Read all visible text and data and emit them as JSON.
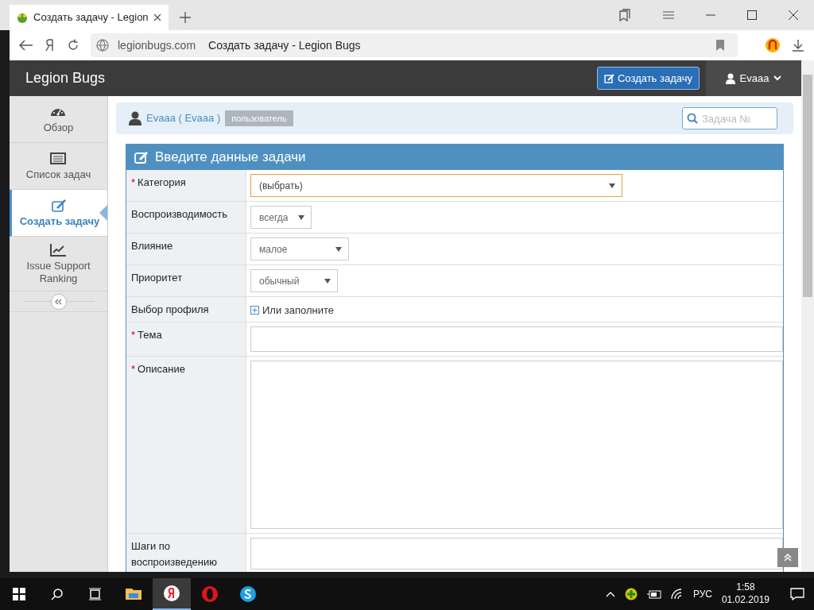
{
  "browser": {
    "tab_title": "Создать задачу - Legion",
    "domain": "legionbugs.com",
    "page_title": "Создать задачу - Legion Bugs"
  },
  "navbar": {
    "brand": "Legion Bugs",
    "create_button": "Создать задачу",
    "user": "Evaaa"
  },
  "sidebar": {
    "items": [
      {
        "label": "Обзор",
        "selected": false
      },
      {
        "label": "Список задач",
        "selected": false
      },
      {
        "label": "Создать задачу",
        "selected": true
      },
      {
        "label": "Issue Support Ranking",
        "selected": false
      }
    ]
  },
  "user_bar": {
    "user": "Evaaa ( Evaaa )",
    "role": "пользователь",
    "search_placeholder": "Задача №"
  },
  "form": {
    "title": "Введите данные задачи",
    "fields": [
      {
        "mark": "*",
        "label": "Категория",
        "kind": "select",
        "value": "(выбрать)",
        "focused": true
      },
      {
        "label": "Воспроизводимость",
        "kind": "select",
        "value": "всегда",
        "focused": false
      },
      {
        "label": "Влияние",
        "kind": "select",
        "value": "малое",
        "focused": false
      },
      {
        "label": "Приоритет",
        "kind": "select",
        "value": "обычный",
        "focused": false
      },
      {
        "label": "Выбор профиля",
        "kind": "link",
        "value": "Или заполните"
      },
      {
        "mark": "*",
        "label": "Тема",
        "kind": "input"
      },
      {
        "mark": "*",
        "label": "Описание",
        "kind": "textarea"
      },
      {
        "label": "Шаги по воспроизведению",
        "kind": "textarea_cut"
      }
    ]
  },
  "taskbar": {
    "apps": [
      {
        "selected": false
      },
      {
        "selected": true
      },
      {
        "selected": false
      },
      {
        "selected": false
      }
    ],
    "language": "РУС",
    "time": "1:58",
    "date": "01.02.2019"
  }
}
